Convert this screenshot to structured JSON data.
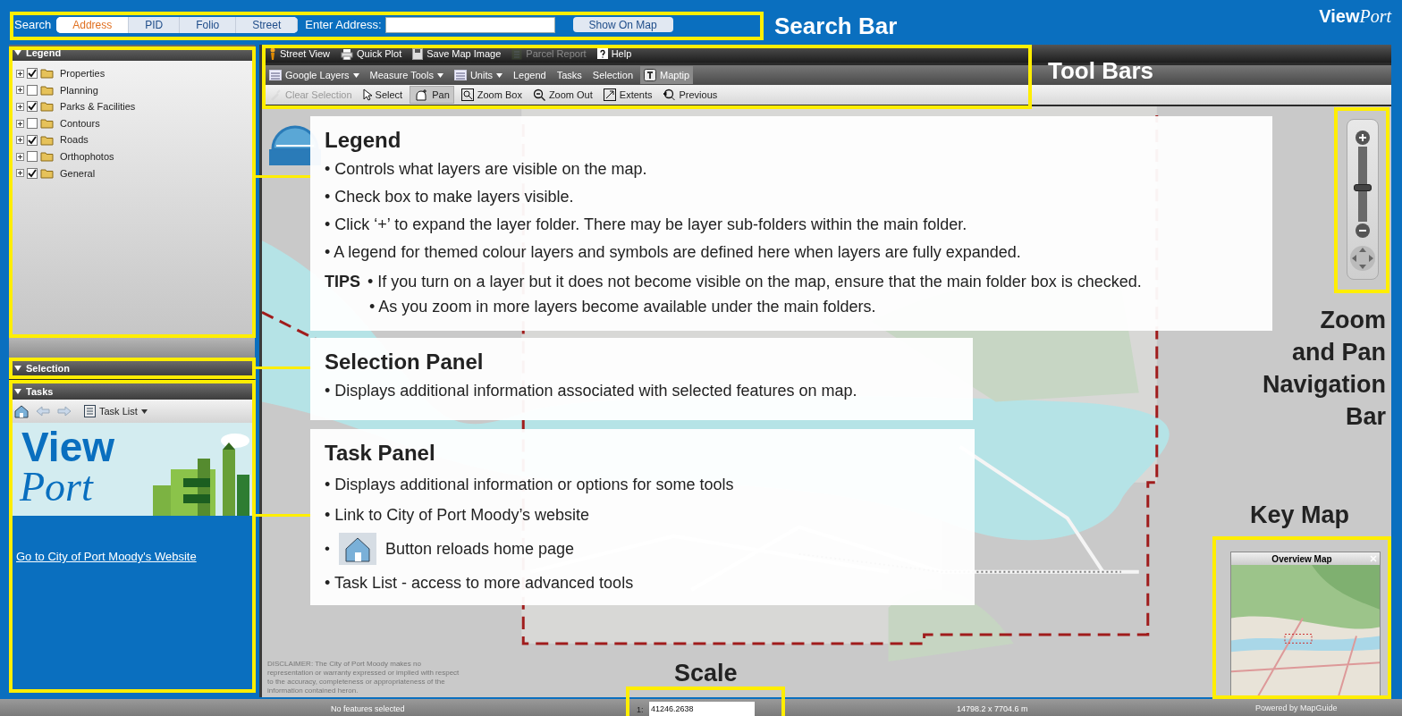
{
  "search_bar": {
    "label": "Search",
    "tabs": [
      {
        "label": "Address",
        "selected": true
      },
      {
        "label": "PID",
        "selected": false
      },
      {
        "label": "Folio",
        "selected": false
      },
      {
        "label": "Street",
        "selected": false
      }
    ],
    "address_label": "Enter Address:",
    "button": "Show On Map"
  },
  "logo": {
    "bold": "View",
    "italic": "Port"
  },
  "legend_panel": {
    "title": "Legend",
    "layers": [
      {
        "name": "Properties",
        "checked": true
      },
      {
        "name": "Planning",
        "checked": false
      },
      {
        "name": "Parks & Facilities",
        "checked": true
      },
      {
        "name": "Contours",
        "checked": false
      },
      {
        "name": "Roads",
        "checked": true
      },
      {
        "name": "Orthophotos",
        "checked": false
      },
      {
        "name": "General",
        "checked": true
      }
    ]
  },
  "selection_panel": {
    "title": "Selection"
  },
  "tasks_panel": {
    "title": "Tasks",
    "task_list": "Task List",
    "banner": {
      "bold": "View",
      "italic": "Port"
    },
    "link": "Go to City of Port Moody's Website"
  },
  "toolbars": [
    [
      {
        "label": "Street View",
        "disabled": false,
        "selected": false,
        "dropdown": false
      },
      {
        "label": "Quick Plot",
        "disabled": false,
        "selected": false,
        "dropdown": false
      },
      {
        "label": "Save Map Image",
        "disabled": false,
        "selected": false,
        "dropdown": false
      },
      {
        "label": "Parcel Report",
        "disabled": true,
        "selected": false,
        "dropdown": false
      },
      {
        "label": "Help",
        "disabled": false,
        "selected": false,
        "dropdown": false
      }
    ],
    [
      {
        "label": "Google Layers",
        "disabled": false,
        "selected": false,
        "dropdown": true
      },
      {
        "label": "Measure Tools",
        "disabled": false,
        "selected": false,
        "dropdown": true
      },
      {
        "label": "Units",
        "disabled": false,
        "selected": false,
        "dropdown": true
      },
      {
        "label": "Legend",
        "disabled": false,
        "selected": false,
        "dropdown": false
      },
      {
        "label": "Tasks",
        "disabled": false,
        "selected": false,
        "dropdown": false
      },
      {
        "label": "Selection",
        "disabled": false,
        "selected": false,
        "dropdown": false
      },
      {
        "label": "Maptip",
        "disabled": false,
        "selected": true,
        "dropdown": false
      }
    ],
    [
      {
        "label": "Clear Selection",
        "disabled": true,
        "selected": false,
        "dropdown": false
      },
      {
        "label": "Select",
        "disabled": false,
        "selected": false,
        "dropdown": false
      },
      {
        "label": "Pan",
        "disabled": false,
        "selected": true,
        "dropdown": false
      },
      {
        "label": "Zoom Box",
        "disabled": false,
        "selected": false,
        "dropdown": false
      },
      {
        "label": "Zoom Out",
        "disabled": false,
        "selected": false,
        "dropdown": false
      },
      {
        "label": "Extents",
        "disabled": false,
        "selected": false,
        "dropdown": false
      },
      {
        "label": "Previous",
        "disabled": false,
        "selected": false,
        "dropdown": false
      }
    ]
  ],
  "zoom": {
    "level": 0.45
  },
  "disclaimer": "DISCLAIMER:  The City of Port Moody makes no representation or warranty expressed or implied with respect to the accuracy, completeness or appropriateness of the information contained heron.",
  "overview_map": {
    "title": "Overview Map"
  },
  "status_bar": {
    "selection": "No features selected",
    "scale_prefix": "1:",
    "scale": "41246.2638",
    "extent": "14798.2 x 7704.6 m",
    "powered_by": "Powered by MapGuide"
  },
  "callouts": [
    {
      "title": "Legend",
      "bullets": [
        {
          "kind": "text",
          "text": "• Controls what layers are visible on the map."
        },
        {
          "kind": "text",
          "text": "• Check box to make layers visible."
        },
        {
          "kind": "text",
          "text": "• Click ‘+’ to expand the layer folder. There may be layer sub-folders within the main folder."
        },
        {
          "kind": "text",
          "text": "• A legend for themed colour layers and symbols are defined here when layers are fully expanded."
        }
      ],
      "tips": {
        "label": "TIPS",
        "bullets": [
          "• If you turn on a layer but it does not become visible on the map, ensure that the main folder box is checked.",
          "• As you zoom in more layers become available under the main folders."
        ]
      }
    },
    {
      "title": "Selection Panel",
      "bullets": [
        {
          "kind": "text",
          "text": "• Displays additional information associated with selected features on map."
        }
      ]
    },
    {
      "title": "Task Panel",
      "bullets": [
        {
          "kind": "text",
          "text": "• Displays additional information or options for some tools"
        },
        {
          "kind": "text",
          "text": "• Link to City of Port Moody’s website"
        },
        {
          "kind": "icon",
          "bullet": "•",
          "text": "Button reloads home page"
        },
        {
          "kind": "text",
          "text": "• Task List - access to more advanced tools"
        }
      ]
    }
  ],
  "labels": {
    "search_bar": "Search Bar",
    "tool_bars": "Tool Bars",
    "navigation": [
      "Zoom",
      "and Pan",
      "Navigation",
      "Bar"
    ],
    "key_map": "Key Map",
    "scale": "Scale"
  }
}
